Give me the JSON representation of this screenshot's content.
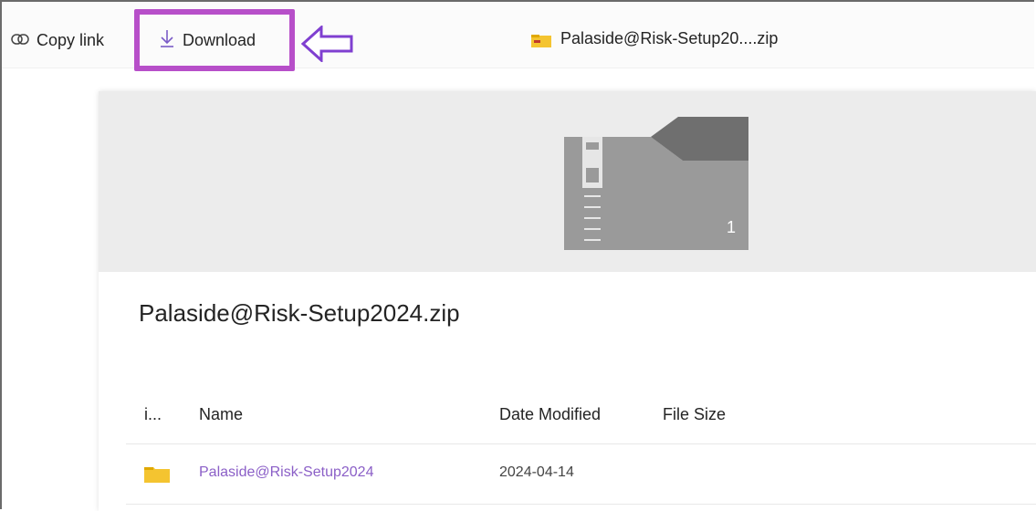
{
  "toolbar": {
    "copy_link_label": "Copy link",
    "download_label": "Download",
    "file_title": "Palaside@Risk-Setup20....zip"
  },
  "preview": {
    "item_count": "1"
  },
  "document": {
    "name": "Palaside@Risk-Setup2024.zip"
  },
  "table": {
    "columns": [
      "i...",
      "Name",
      "Date Modified",
      "File Size"
    ],
    "rows": [
      {
        "name": "Palaside@Risk-Setup2024",
        "date_modified": "2024-04-14",
        "file_size": ""
      }
    ]
  },
  "colors": {
    "highlight": "#b74fc9",
    "link": "#8b5fc7",
    "folder": "#f4c430"
  }
}
